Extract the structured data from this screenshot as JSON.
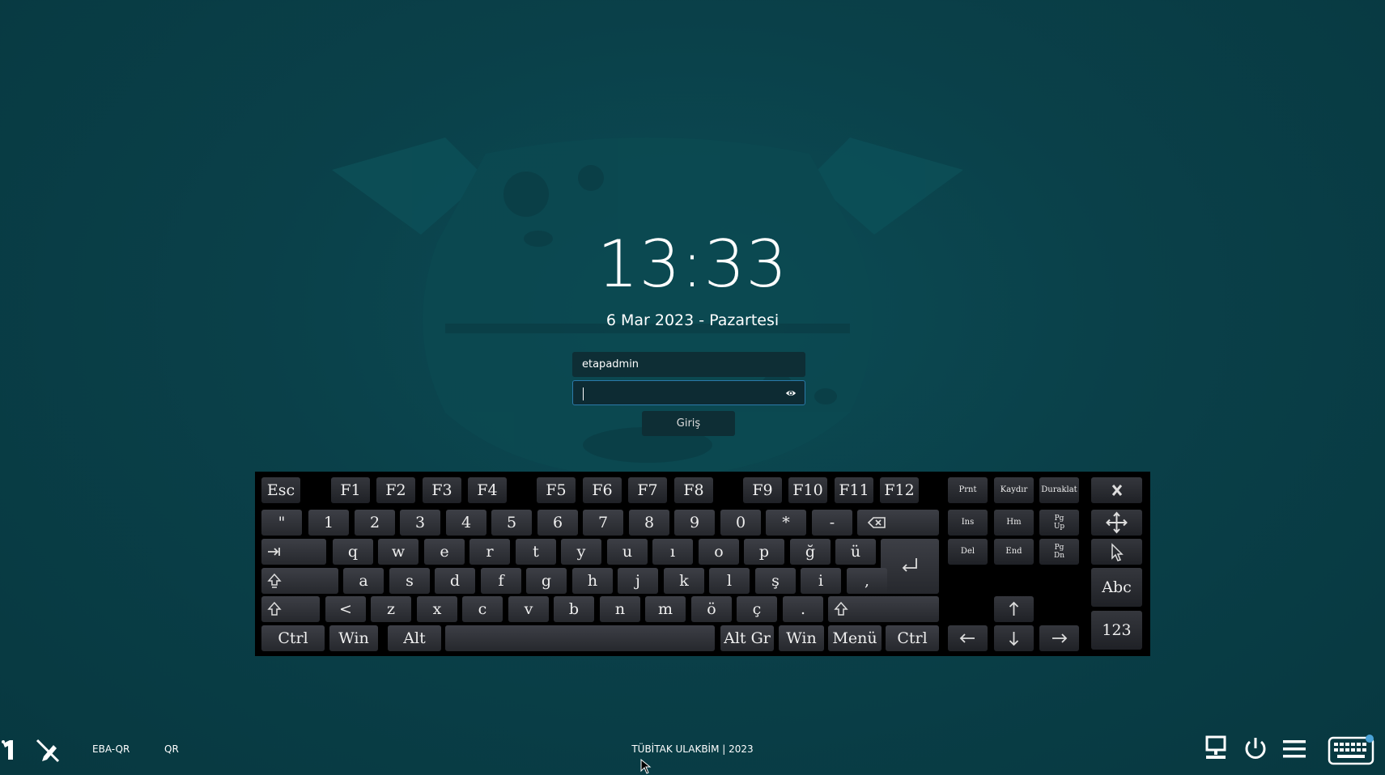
{
  "clock": {
    "time": "13:33",
    "date": "6 Mar 2023 - Pazartesi"
  },
  "login": {
    "username": "etapadmin",
    "password": "",
    "submit_label": "Giriş"
  },
  "keyboard": {
    "row0": [
      "Esc",
      "F1",
      "F2",
      "F3",
      "F4",
      "F5",
      "F6",
      "F7",
      "F8",
      "F9",
      "F10",
      "F11",
      "F12",
      "Prnt",
      "Kaydır",
      "Duraklat"
    ],
    "row1": [
      "\"",
      "1",
      "2",
      "3",
      "4",
      "5",
      "6",
      "7",
      "8",
      "9",
      "0",
      "*",
      "-",
      "Ins",
      "Hm",
      "Pg\nUp"
    ],
    "row2": [
      "q",
      "w",
      "e",
      "r",
      "t",
      "y",
      "u",
      "ı",
      "o",
      "p",
      "ğ",
      "ü",
      "Del",
      "End",
      "Pg\nDn"
    ],
    "row3": [
      "a",
      "s",
      "d",
      "f",
      "g",
      "h",
      "j",
      "k",
      "l",
      "ş",
      "i",
      ","
    ],
    "row4": [
      "<",
      "z",
      "x",
      "c",
      "v",
      "b",
      "n",
      "m",
      "ö",
      "ç",
      "."
    ],
    "row5": [
      "Ctrl",
      "Win",
      "Alt",
      "Alt Gr",
      "Win",
      "Menü",
      "Ctrl"
    ],
    "side": [
      "Abc",
      "123"
    ],
    "icons": [
      "backspace-icon",
      "tab-icon",
      "caps-lock-icon",
      "shift-icon",
      "enter-icon",
      "close-icon",
      "move-icon",
      "pointer-icon",
      "arrow-up-icon",
      "arrow-down-icon",
      "arrow-left-icon",
      "arrow-right-icon"
    ]
  },
  "taskbar": {
    "left_items": [
      "EBA-QR",
      "QR"
    ],
    "footer": "TÜBİTAK ULAKBİM | 2023",
    "icons": [
      "one-icon",
      "no-pen-icon",
      "network-icon",
      "power-icon",
      "menu-icon",
      "keyboard-icon"
    ]
  },
  "colors": {
    "background": "#0a4049",
    "field": "#0e2e35",
    "focus_border": "#2b79a8",
    "key": "#2f3137"
  }
}
